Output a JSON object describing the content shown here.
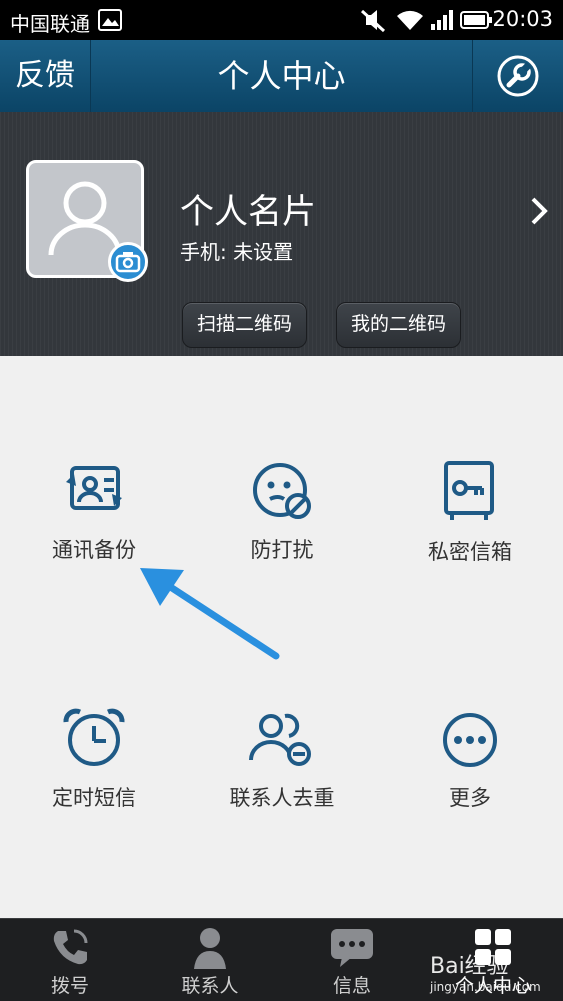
{
  "status": {
    "carrier": "中国联通",
    "time": "20:03"
  },
  "header": {
    "feedback": "反馈",
    "title": "个人中心"
  },
  "profile": {
    "card_title": "个人名片",
    "phone_label": "手机: 未设置",
    "scan_qr": "扫描二维码",
    "my_qr": "我的二维码"
  },
  "grid": [
    {
      "label": "通讯备份",
      "icon": "contact-backup-icon"
    },
    {
      "label": "防打扰",
      "icon": "do-not-disturb-icon"
    },
    {
      "label": "私密信箱",
      "icon": "private-safe-icon"
    },
    {
      "label": "定时短信",
      "icon": "alarm-clock-icon"
    },
    {
      "label": "联系人去重",
      "icon": "contact-dedup-icon"
    },
    {
      "label": "更多",
      "icon": "more-icon"
    }
  ],
  "nav": [
    {
      "label": "拨号",
      "icon": "phone-icon"
    },
    {
      "label": "联系人",
      "icon": "person-icon"
    },
    {
      "label": "信息",
      "icon": "chat-bubble-icon"
    },
    {
      "label": "个人中心",
      "icon": "grid-icon"
    }
  ],
  "watermark": {
    "line1": "Bai经验",
    "line2": "jingyan.baidu.com"
  },
  "colors": {
    "icon": "#1f5a86",
    "arrow": "#2a90df",
    "header": "#0f4d73"
  }
}
